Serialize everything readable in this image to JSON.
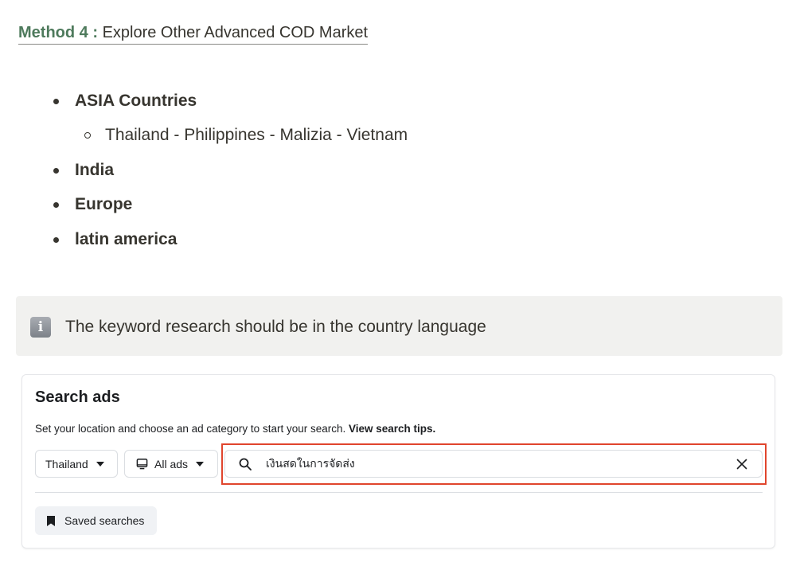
{
  "heading": {
    "prefix": "Method 4 :",
    "title": "Explore Other Advanced COD Market"
  },
  "markets": {
    "items": [
      {
        "label": "ASIA Countries",
        "sub": [
          "Thailand - Philippines - Malizia - Vietnam"
        ]
      },
      {
        "label": "India"
      },
      {
        "label": "Europe"
      },
      {
        "label": "latin america"
      }
    ]
  },
  "callout": {
    "icon": "info-icon",
    "text": "The keyword research should be in the country language"
  },
  "search_ads": {
    "title": "Search ads",
    "description": "Set your location and choose an ad category to start your search.",
    "tips_link": "View search tips.",
    "country_select": "Thailand",
    "category_select": "All ads",
    "search_value": "เงินสดในการจัดส่ง",
    "saved_searches_label": "Saved searches"
  },
  "colors": {
    "heading_accent": "#4e7a5c",
    "highlight_border": "#e0452d",
    "callout_bg": "#f1f1ef"
  }
}
